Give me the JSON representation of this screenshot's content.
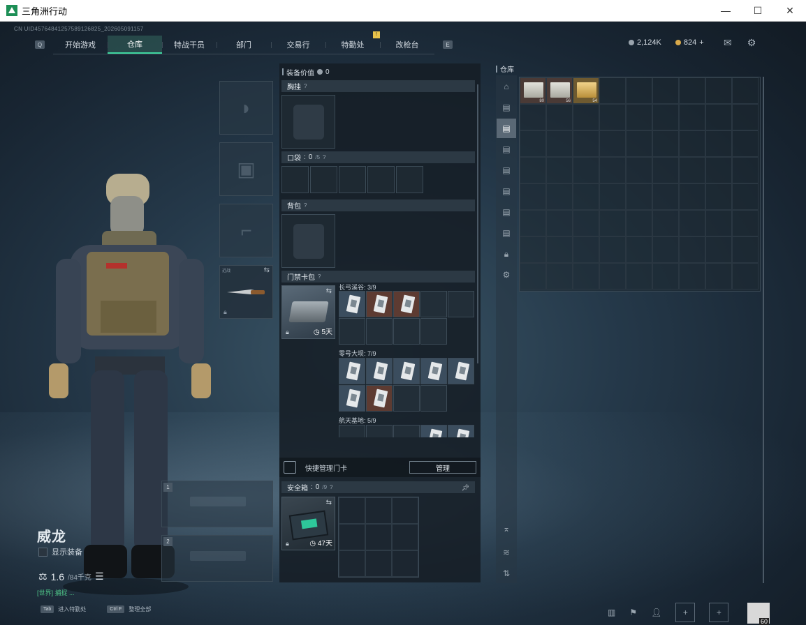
{
  "window": {
    "title": "三角洲行动"
  },
  "uid": "CN UID45764841257589126825_202605091157",
  "nav": {
    "left_key": "Q",
    "right_key": "E",
    "tabs": [
      {
        "label": "开始游戏"
      },
      {
        "label": "仓库",
        "active": true
      },
      {
        "label": "特战干员"
      },
      {
        "label": "部门"
      },
      {
        "label": "交易行"
      },
      {
        "label": "特勤处"
      },
      {
        "label": "改枪台"
      }
    ],
    "badge": "!"
  },
  "currency": {
    "silver": "2,124K",
    "gold": "824",
    "add": "+"
  },
  "character": {
    "name": "威龙",
    "show_equipment": "显示装备",
    "weight": "1.6",
    "weight_max": "/84千克",
    "chat": "[世界] 捕捉 ..."
  },
  "melee_slot": {
    "label": "近战"
  },
  "weapon_slots": [
    {
      "num": "1"
    },
    {
      "num": "2"
    }
  ],
  "hints": [
    {
      "key": "Tab",
      "label": "进入特勤处"
    },
    {
      "key": "Ctrl F",
      "label": "整理全部"
    }
  ],
  "middle": {
    "equip_value_label": "装备价值",
    "equip_value": "0",
    "sections": {
      "chest": "胸挂",
      "pocket": "口袋",
      "pocket_count": "0",
      "pocket_max": "/5",
      "backpack": "背包",
      "keycase": "门禁卡包"
    },
    "help": "?",
    "keycase_days": "5天",
    "maps": [
      {
        "label": "长弓溪谷: 3/9"
      },
      {
        "label": "零号大坝: 7/9"
      },
      {
        "label": "航天基地: 5/9"
      }
    ],
    "quick_manage": "快捷管理门卡",
    "manage_btn": "管理",
    "safe_label": "安全箱",
    "safe_count": "0",
    "safe_max": "/9",
    "safe_days": "47天"
  },
  "storage": {
    "title": "仓库",
    "items": [
      {
        "count": "80",
        "color": "#4a3a36"
      },
      {
        "count": "56",
        "color": "#4a3a36"
      },
      {
        "count": "54",
        "color": "#6e5a30"
      }
    ]
  },
  "avatar_level": "60"
}
